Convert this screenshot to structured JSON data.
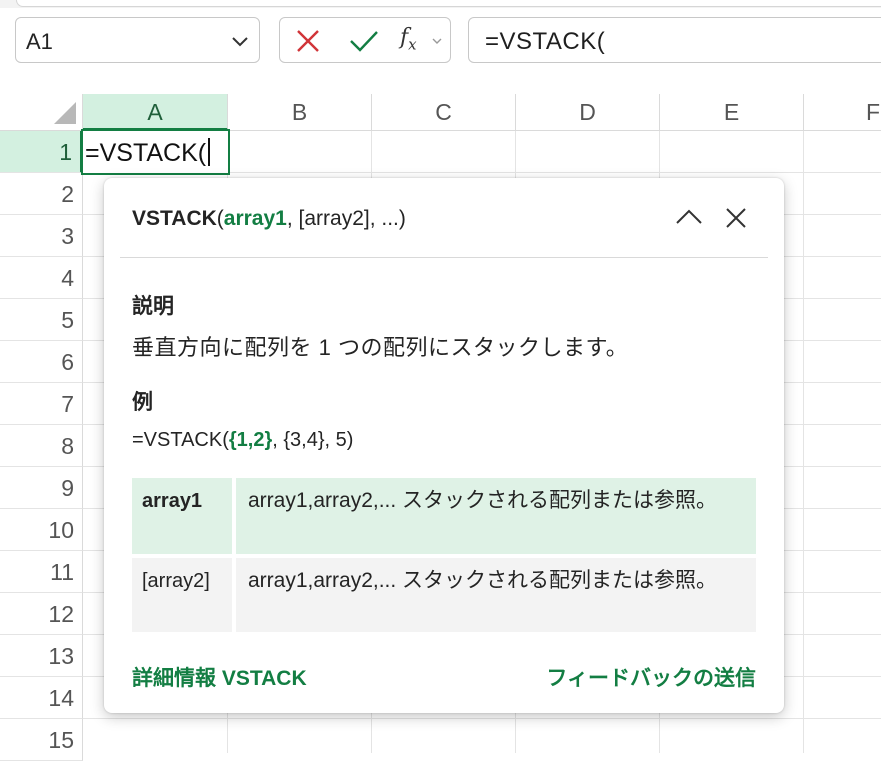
{
  "name_box": {
    "value": "A1",
    "icon": "chevron-down-icon"
  },
  "formula_controls": {
    "cancel_icon": "close-x-icon",
    "enter_icon": "checkmark-icon",
    "function_label": "f",
    "function_sub": "x"
  },
  "formula_bar": {
    "value": "=VSTACK("
  },
  "columns": [
    "A",
    "B",
    "C",
    "D",
    "E",
    "F"
  ],
  "rows": [
    "1",
    "2",
    "3",
    "4",
    "5",
    "6",
    "7",
    "8",
    "9",
    "10",
    "11",
    "12",
    "13",
    "14",
    "15"
  ],
  "active_cell": {
    "address": "A1",
    "value": "=VSTACK("
  },
  "tooltip": {
    "signature": {
      "function": "VSTACK",
      "open": "(",
      "arg1": "array1",
      "rest": ", [array2], ...)"
    },
    "description_heading": "説明",
    "description": "垂直方向に配列を 1 つの配列にスタックします。",
    "example_heading": "例",
    "example": {
      "prefix": "=VSTACK(",
      "highlight": "{1,2}",
      "suffix": ", {3,4}, 5)"
    },
    "params": [
      {
        "name": "array1",
        "description": "array1,array2,... スタックされる配列または参照。"
      },
      {
        "name": "[array2]",
        "description": "array1,array2,... スタックされる配列または参照。"
      }
    ],
    "more_info_link": "詳細情報 VSTACK",
    "feedback_link": "フィードバックの送信",
    "accent_color": "#137e43"
  }
}
